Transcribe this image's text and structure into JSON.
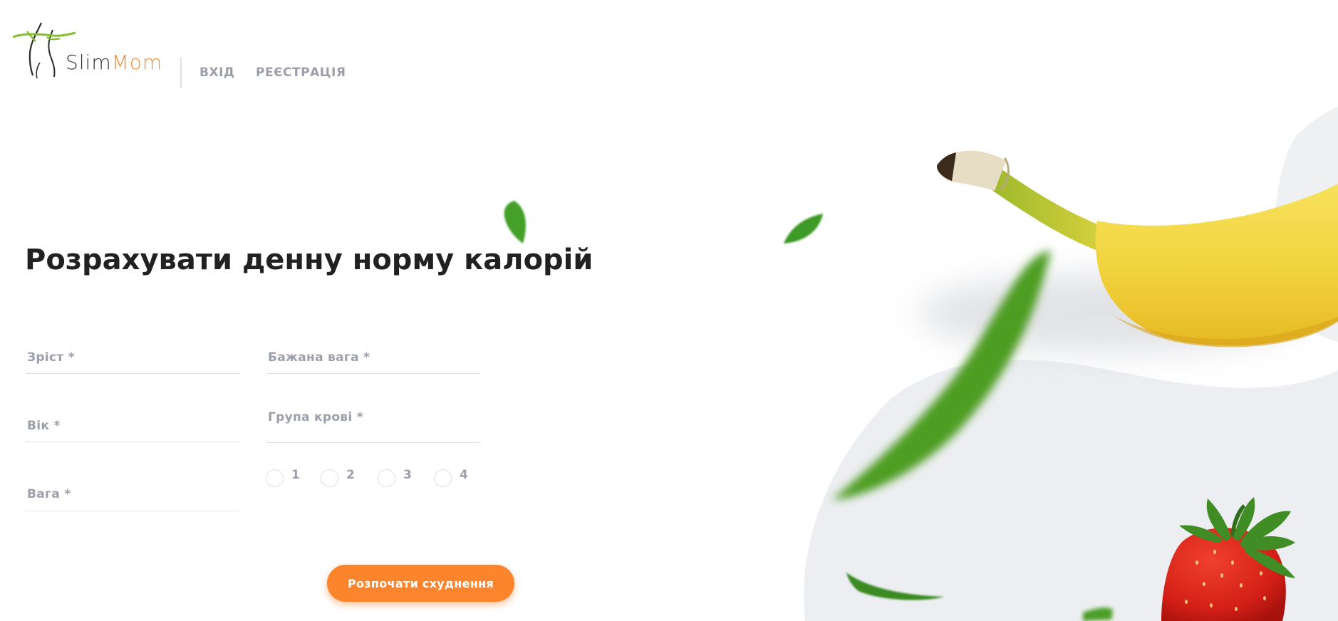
{
  "brand": {
    "name_part1": "Slim",
    "name_part2": "Mom",
    "accent_color": "#fc842d",
    "logo_green": "#86bd31"
  },
  "nav": {
    "login": "ВХІД",
    "register": "РЕЄСТРАЦІЯ"
  },
  "main": {
    "title": "Розрахувати денну норму калорій",
    "fields": {
      "height": {
        "label": "Зріст *",
        "value": ""
      },
      "age": {
        "label": "Вік *",
        "value": ""
      },
      "weight": {
        "label": "Вага *",
        "value": ""
      },
      "desired_weight": {
        "label": "Бажана вага *",
        "value": ""
      },
      "blood_type": {
        "label": "Група крові *"
      }
    },
    "blood_options": [
      "1",
      "2",
      "3",
      "4"
    ],
    "submit_label": "Розпочати схуднення"
  },
  "decorations": [
    "banana-image",
    "strawberry-image",
    "leaf-image",
    "grey-blob-shape"
  ]
}
